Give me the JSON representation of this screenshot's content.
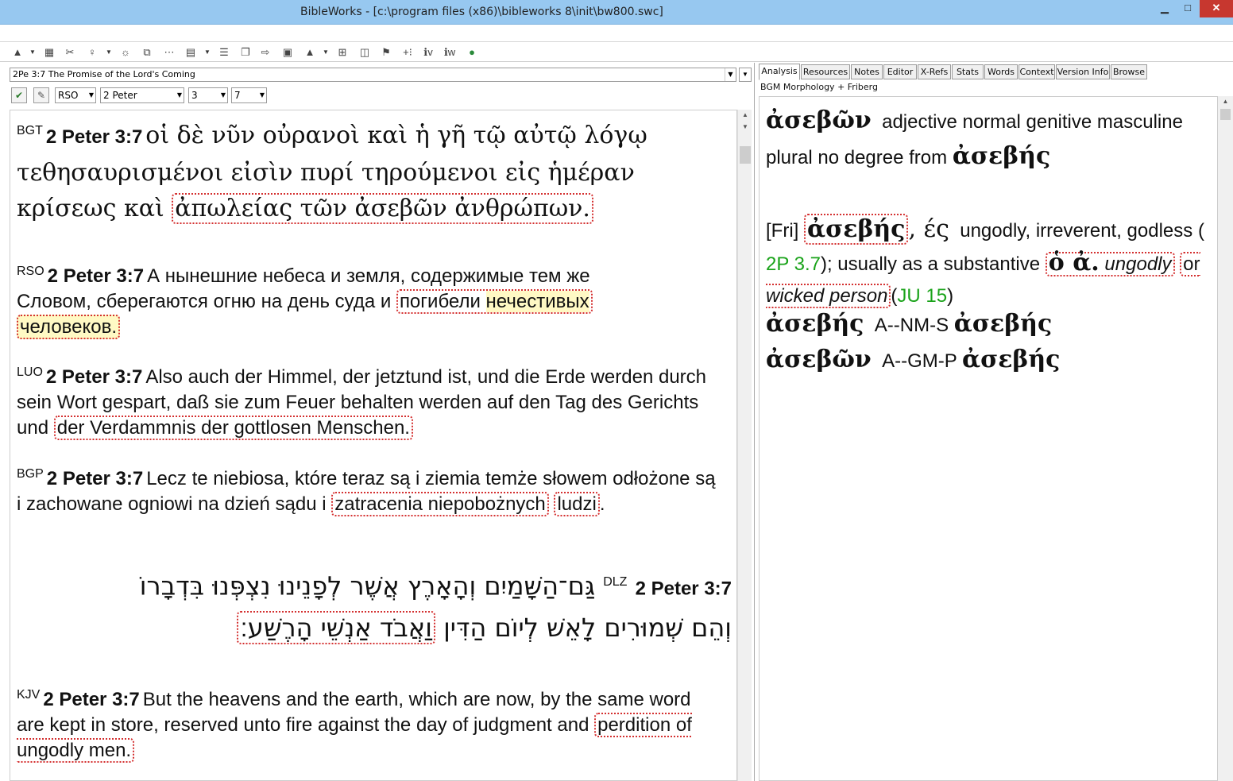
{
  "window": {
    "title": "BibleWorks - [c:\\program files (x86)\\bibleworks 8\\init\\bw800.swc]",
    "minimize": "▁",
    "maximize": "□",
    "close": "✕"
  },
  "toolbar": {
    "icons": [
      "▲",
      "▦",
      "✂",
      "♀",
      "☼",
      "⧉",
      "⋯",
      "▤",
      "☰",
      "❐",
      "⇨",
      "▣",
      "▲",
      "⊞",
      "◫",
      "⚑",
      "+⁝",
      "ℹv",
      "ℹw",
      "●"
    ]
  },
  "nav": {
    "reference_title": "2Pe 3:7 The Promise of the Lord's Coming",
    "version": "RSO",
    "book": "2 Peter",
    "chapter": "3",
    "verse": "7"
  },
  "verses": [
    {
      "version": "BGT",
      "ref": "2 Peter 3:7",
      "pre": "οἱ δὲ νῦν οὐρανοὶ καὶ ἡ γῆ τῷ αὐτῷ λόγῳ τεθησαυρισμένοι εἰσὶν πυρί τηρούμενοι εἰς ἡμέραν κρίσεως καὶ ",
      "hl": "ἀπωλείας τῶν ἀσεβῶν ἀνθρώπων."
    },
    {
      "version": "RSO",
      "ref": "2 Peter 3:7",
      "pre": "А нынешние небеса и земля, содержимые тем же Словом, сберегаются огню на день суда и ",
      "hl_a": "погибели ",
      "hl_b": "нечестивых",
      "hl_c": "человеков."
    },
    {
      "version": "LUO",
      "ref": "2 Peter 3:7",
      "pre": "Also auch der Himmel, der jetztund ist, und die Erde werden durch sein Wort gespart, daß sie zum Feuer behalten werden auf den Tag des Gerichts und ",
      "hl": "der Verdammnis der gottlosen Menschen."
    },
    {
      "version": "BGP",
      "ref": "2 Peter 3:7",
      "pre": "Lecz te niebiosa, które teraz są i ziemia temże słowem odłożone są i zachowane ogniowi na dzień sądu i ",
      "hl_a": "zatracenia niepobożnych",
      "hl_b": "ludzi",
      "post": "."
    },
    {
      "version": "DLZ",
      "ref": "2 Peter 3:7",
      "line1": "גַּם־הַשָּׁמַיִם וְהָאָרֶץ אֲשֶׁר לְפָנֵינוּ נִצְפְּנוּ בִּדְבָרוֹ",
      "pre2": "וְהֵם שְׁמוּרִים לָאֵשׁ לְיוֹם הַדִּין ",
      "hl": "וַאֲבֹד אַנְשֵׁי הָרֶשַׁע׃"
    },
    {
      "version": "KJV",
      "ref": "2 Peter 3:7",
      "pre": "But the heavens and the earth, which are now, by the same word are kept in store, reserved unto fire against the day of judgment and ",
      "hl": "perdition of ungodly men."
    }
  ],
  "tabs": [
    "Analysis",
    "Resources",
    "Notes",
    "Editor",
    "X-Refs",
    "Stats",
    "Words",
    "Context",
    "Version Info",
    "Browse"
  ],
  "analysis": {
    "subtitle": "BGM Morphology + Friberg",
    "word": "ἀσεβῶν",
    "parse_1": "adjective normal genitive masculine",
    "parse_2": "plural no degree from",
    "lemma": "ἀσεβής",
    "fri_tag": "[Fri]",
    "fri_lemma": "ἀσεβής",
    "fri_ending": ", ές",
    "fri_def": "ungodly, irreverent, godless (",
    "ref_2p": "2P 3.7",
    "def_2": "); usually as a substantive",
    "article": "ὁ ἀ.",
    "ungodly": "ungodly",
    "or": "or",
    "wicked": "wicked person",
    "paren_open": "(",
    "ref_ju": "JU 15",
    "paren_close": ")",
    "morph_1_word": "ἀσεβής",
    "morph_1_code": "A--NM-S",
    "morph_1_lemma": "ἀσεβής",
    "morph_2_word": "ἀσεβῶν",
    "morph_2_code": "A--GM-P",
    "morph_2_lemma": "ἀσεβής"
  }
}
